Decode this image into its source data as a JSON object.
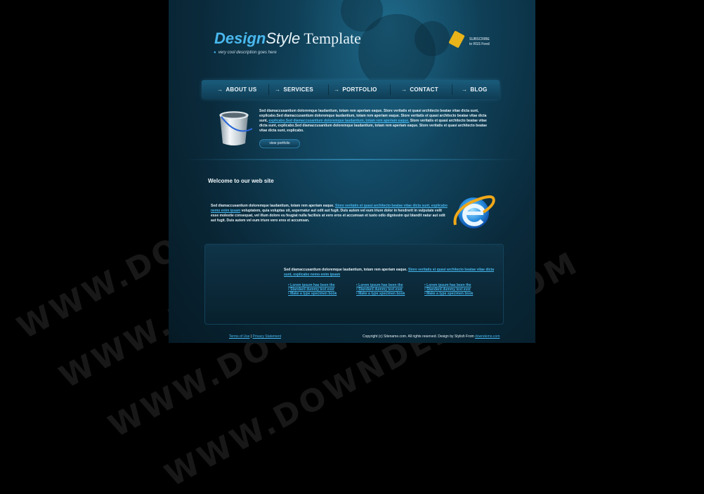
{
  "header": {
    "logo_design": "Design",
    "logo_style": "Style",
    "logo_template": " Template",
    "tagline": "very cool description goes here",
    "rss_line1": "SUBSCRIBE",
    "rss_line2": "to RSS Feed"
  },
  "nav": {
    "items": [
      {
        "label": "ABOUT US"
      },
      {
        "label": "SERVICES"
      },
      {
        "label": "PORTFOLIO"
      },
      {
        "label": "CONTACT"
      },
      {
        "label": "BLOG"
      }
    ],
    "arrow": "→"
  },
  "intro": {
    "text1": "Sed diamaccusantium doloremque laudantium, totam rem aperiam eaque. Store veritatis et quasi architecto beatae vitae dicta sunt, explicabo.Sed diamaccusantium doloremque laudantium, totam rem aperiam eaque. Store veritatis et quasi architecto beatae vitae dicta sunt, ",
    "link1": "explicabo.Sed diamaccusantium doloremque laudantium, totam rem aperiam eaque.",
    "text2": " Store veritatis et quasi architecto beatae vitae dicta sunt, explicabo.Sed diamaccusantium doloremque laudantium, totam rem aperiam eaque. Store veritatis et quasi architecto beatae vitae dicta sunt, explicabo.",
    "button": "view portfolio"
  },
  "welcome": {
    "title": "Welcome to our web site",
    "text1": "Sed diamaccusantium doloremque laudantium, totam rem aperiam eaque. ",
    "link1": "Store veritatis et quasi architecto beatae vitae dicta sunt, explicabo nemo enim ipsam",
    "text2": " voluptatem, quia voluptas sit, aspernatur aut odit aut fugit. Duis autem vel eum iriure dolor in hendrerit in vulputate velit esse molestie consequat, vel illum dolore eu feugiat nulla facilisis at vero eros et accumsan et iusto odio dignissim qui blandit natur aut odit aut fugit. Duis autem vel eum iriure vero eros et accumsan."
  },
  "panel": {
    "text1": "Sed diamaccusantium doloremque laudantium, totam rem aperiam eaque. ",
    "link1": "Store veritatis et quasi architecto beatae vitae dicta sunt, explicabo nemo enim ipsam",
    "col1": [
      "• Lorem ipsum has been the",
      "• Standard dummy text ever",
      "• Make a type specimen book"
    ],
    "col2": [
      "• Lorem ipsum has been the",
      "• Standard dummy text ever",
      "• Make a type specimen book"
    ],
    "col3": [
      "• Lorem ipsum has been the",
      "• Standard dummy text ever",
      "• Make a type specimen book"
    ]
  },
  "footer": {
    "terms": "Terms of Use",
    "sep": " | ",
    "privacy": "Privacy Statement",
    "copyright": "Copyright (c) Sitename.com. All rights reserved. Design by Stylish From ",
    "credit_link": "downdemo.com"
  },
  "watermark": {
    "text": "WWW.DOWNDEMO.COM"
  },
  "colors": {
    "accent": "#46b7ee",
    "rss": "#e8b41a",
    "bg": "#000000"
  }
}
